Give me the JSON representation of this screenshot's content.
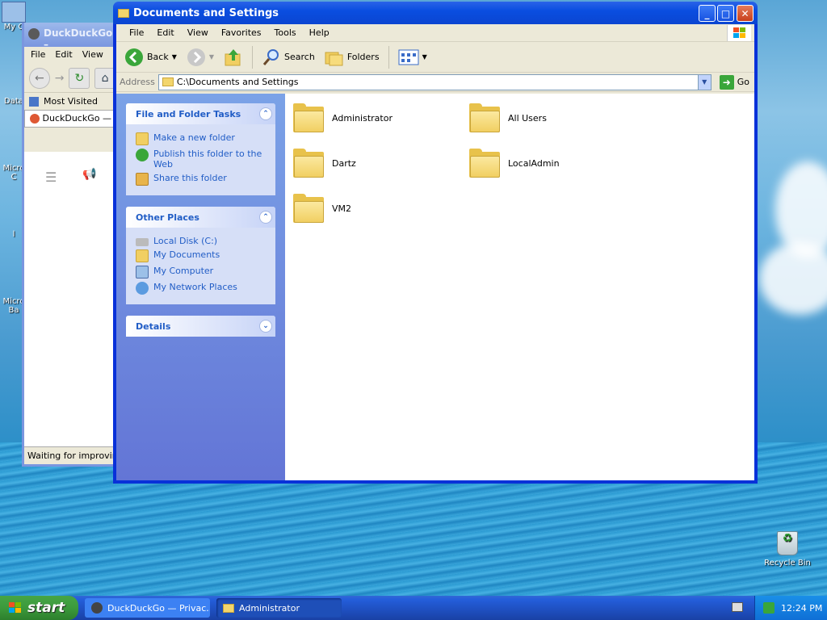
{
  "desktop": {
    "icons": [
      {
        "label": "My C",
        "name": "my-computer"
      },
      {
        "label": "Data",
        "name": "data"
      },
      {
        "label": "Micro\nC",
        "name": "microsoft-c"
      },
      {
        "label": "l",
        "name": "item"
      },
      {
        "label": "Micro\nBa",
        "name": "microsoft-ba"
      }
    ],
    "recycle_bin": "Recycle Bin"
  },
  "browser": {
    "title": "DuckDuckGo –",
    "menu": [
      "File",
      "Edit",
      "View"
    ],
    "bookmark": "Most Visited",
    "tab": "DuckDuckGo — Pri",
    "status": "Waiting for improving."
  },
  "explorer": {
    "title": "Documents and Settings",
    "menu": [
      "File",
      "Edit",
      "View",
      "Favorites",
      "Tools",
      "Help"
    ],
    "toolbar": {
      "back": "Back",
      "search": "Search",
      "folders": "Folders"
    },
    "address_label": "Address",
    "address_value": "C:\\Documents and Settings",
    "go": "Go",
    "task_groups": [
      {
        "title": "File and Folder Tasks",
        "links": [
          "Make a new folder",
          "Publish this folder to the Web",
          "Share this folder"
        ]
      },
      {
        "title": "Other Places",
        "links": [
          "Local Disk (C:)",
          "My Documents",
          "My Computer",
          "My Network Places"
        ]
      },
      {
        "title": "Details",
        "links": []
      }
    ],
    "folders": [
      "Administrator",
      "All Users",
      "Dartz",
      "LocalAdmin",
      "VM2"
    ]
  },
  "taskbar": {
    "start": "start",
    "tasks": [
      "DuckDuckGo — Privac...",
      "Administrator"
    ],
    "clock": "12:24 PM"
  }
}
